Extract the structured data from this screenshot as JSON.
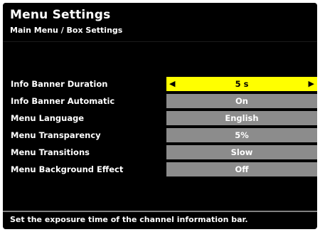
{
  "header": {
    "title": "Menu Settings",
    "breadcrumb": "Main Menu / Box Settings"
  },
  "settings": [
    {
      "label": "Info Banner Duration",
      "value": "5 s",
      "selected": true
    },
    {
      "label": "Info Banner Automatic",
      "value": "On",
      "selected": false
    },
    {
      "label": "Menu Language",
      "value": "English",
      "selected": false
    },
    {
      "label": "Menu Transparency",
      "value": "5%",
      "selected": false
    },
    {
      "label": "Menu Transitions",
      "value": "Slow",
      "selected": false
    },
    {
      "label": "Menu Background Effect",
      "value": "Off",
      "selected": false
    }
  ],
  "footer": {
    "help_text": "Set the exposure time of the channel information bar."
  },
  "colors": {
    "background": "#000000",
    "selected_value_bg": "#ffff00",
    "value_bg": "#8c8c8c",
    "text": "#ffffff"
  },
  "icons": {
    "left": "arrow-left-icon",
    "right": "arrow-right-icon"
  }
}
